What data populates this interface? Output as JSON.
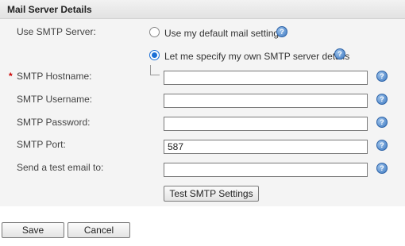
{
  "panel": {
    "title": "Mail Server Details"
  },
  "smtp_server": {
    "label": "Use SMTP Server:",
    "options": [
      {
        "label": "Use my default mail settings",
        "selected": false
      },
      {
        "label": "Let me specify my own SMTP server details",
        "selected": true
      }
    ]
  },
  "fields": {
    "hostname": {
      "label": "SMTP Hostname:",
      "required_mark": "*",
      "value": ""
    },
    "username": {
      "label": "SMTP Username:",
      "value": ""
    },
    "password": {
      "label": "SMTP Password:",
      "value": ""
    },
    "port": {
      "label": "SMTP Port:",
      "value": "587"
    },
    "test_email": {
      "label": "Send a test email to:",
      "value": ""
    }
  },
  "help_icon": {
    "icon": "help-icon",
    "glyph": "?",
    "color": "#3c78c0"
  },
  "buttons": {
    "test": "Test SMTP Settings",
    "save": "Save",
    "cancel": "Cancel"
  }
}
